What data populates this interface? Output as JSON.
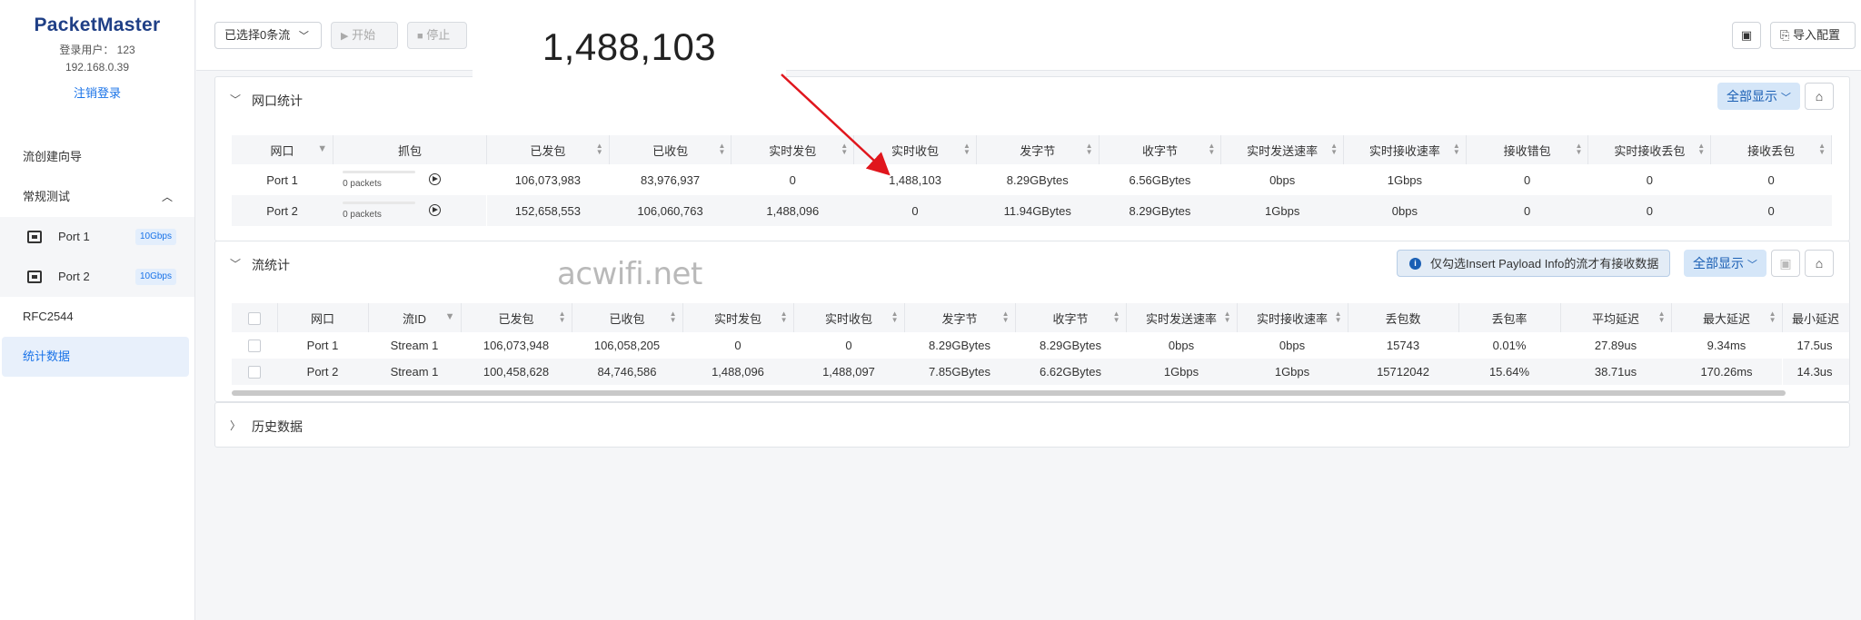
{
  "sidebar": {
    "logo": "PacketMaster",
    "user": "登录用户： 123",
    "ip": "192.168.0.39",
    "logout": "注销登录",
    "wizard": "流创建向导",
    "regular_test": "常规测试",
    "ports": [
      {
        "label": "Port 1",
        "badge": "10Gbps"
      },
      {
        "label": "Port 2",
        "badge": "10Gbps"
      }
    ],
    "rfc": "RFC2544",
    "stats": "统计数据"
  },
  "toolbar": {
    "select_streams": "已选择0条流",
    "start": "开始",
    "stop": "停止",
    "import": "导入配置"
  },
  "zoom_value": "1,488,103",
  "port_stats": {
    "title": "网口统计",
    "show_all": "全部显示",
    "headers": [
      "网口",
      "抓包",
      "已发包",
      "已收包",
      "实时发包",
      "实时收包",
      "发字节",
      "收字节",
      "实时发送速率",
      "实时接收速率",
      "接收错包",
      "实时接收丢包",
      "接收丢包"
    ],
    "rows": [
      {
        "port": "Port 1",
        "capture": "0 packets",
        "cells": [
          "106,073,983",
          "83,976,937",
          "0",
          "1,488,103",
          "8.29GBytes",
          "6.56GBytes",
          "0bps",
          "1Gbps",
          "0",
          "0",
          "0"
        ]
      },
      {
        "port": "Port 2",
        "capture": "0 packets",
        "cells": [
          "152,658,553",
          "106,060,763",
          "1,488,096",
          "0",
          "11.94GBytes",
          "8.29GBytes",
          "1Gbps",
          "0bps",
          "0",
          "0",
          "0"
        ]
      }
    ]
  },
  "stream_stats": {
    "title": "流统计",
    "info": "仅勾选Insert Payload Info的流才有接收数据",
    "show_all": "全部显示",
    "headers": [
      "网口",
      "流ID",
      "已发包",
      "已收包",
      "实时发包",
      "实时收包",
      "发字节",
      "收字节",
      "实时发送速率",
      "实时接收速率",
      "丢包数",
      "丢包率",
      "平均延迟",
      "最大延迟",
      "最小延迟"
    ],
    "rows": [
      {
        "cells": [
          "Port 1",
          "Stream 1",
          "106,073,948",
          "106,058,205",
          "0",
          "0",
          "8.29GBytes",
          "8.29GBytes",
          "0bps",
          "0bps",
          "15743",
          "0.01%",
          "27.89us",
          "9.34ms",
          "17.5us"
        ]
      },
      {
        "cells": [
          "Port 2",
          "Stream 1",
          "100,458,628",
          "84,746,586",
          "1,488,096",
          "1,488,097",
          "7.85GBytes",
          "6.62GBytes",
          "1Gbps",
          "1Gbps",
          "15712042",
          "15.64%",
          "38.71us",
          "170.26ms",
          "14.3us"
        ]
      }
    ]
  },
  "history": {
    "title": "历史数据"
  },
  "watermark": "acwifi.net",
  "colors": {
    "accent": "#1a73e8",
    "arrow": "#e0161d",
    "logo": "#1f3f86"
  }
}
